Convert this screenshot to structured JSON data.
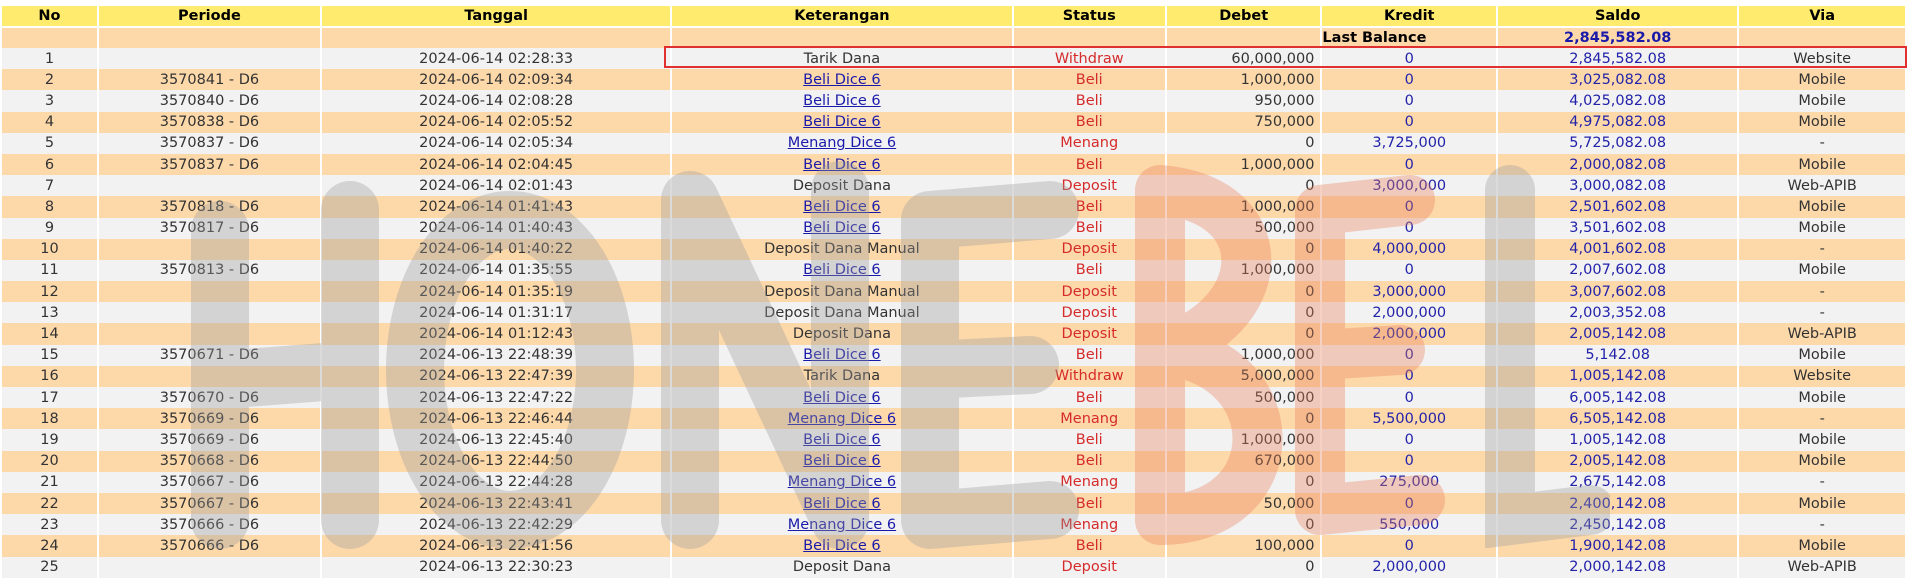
{
  "headers": [
    "No",
    "Periode",
    "Tanggal",
    "Keterangan",
    "Status",
    "Debet",
    "Kredit",
    "Saldo",
    "Via"
  ],
  "last_balance": {
    "label": "Last Balance",
    "value": "2,845,582.08"
  },
  "rows": [
    {
      "no": "1",
      "periode": "",
      "tanggal": "2024-06-14 02:28:33",
      "keterangan": "Tarik Dana",
      "link": false,
      "status": "Withdraw",
      "debet": "60,000,000",
      "kredit": "0",
      "saldo": "2,845,582.08",
      "via": "Website"
    },
    {
      "no": "2",
      "periode": "3570841 - D6",
      "tanggal": "2024-06-14 02:09:34",
      "keterangan": "Beli Dice 6",
      "link": true,
      "status": "Beli",
      "debet": "1,000,000",
      "kredit": "0",
      "saldo": "3,025,082.08",
      "via": "Mobile"
    },
    {
      "no": "3",
      "periode": "3570840 - D6",
      "tanggal": "2024-06-14 02:08:28",
      "keterangan": "Beli Dice 6",
      "link": true,
      "status": "Beli",
      "debet": "950,000",
      "kredit": "0",
      "saldo": "4,025,082.08",
      "via": "Mobile"
    },
    {
      "no": "4",
      "periode": "3570838 - D6",
      "tanggal": "2024-06-14 02:05:52",
      "keterangan": "Beli Dice 6",
      "link": true,
      "status": "Beli",
      "debet": "750,000",
      "kredit": "0",
      "saldo": "4,975,082.08",
      "via": "Mobile"
    },
    {
      "no": "5",
      "periode": "3570837 - D6",
      "tanggal": "2024-06-14 02:05:34",
      "keterangan": "Menang Dice 6",
      "link": true,
      "status": "Menang",
      "debet": "0",
      "kredit": "3,725,000",
      "saldo": "5,725,082.08",
      "via": "-"
    },
    {
      "no": "6",
      "periode": "3570837 - D6",
      "tanggal": "2024-06-14 02:04:45",
      "keterangan": "Beli Dice 6",
      "link": true,
      "status": "Beli",
      "debet": "1,000,000",
      "kredit": "0",
      "saldo": "2,000,082.08",
      "via": "Mobile"
    },
    {
      "no": "7",
      "periode": "",
      "tanggal": "2024-06-14 02:01:43",
      "keterangan": "Deposit Dana",
      "link": false,
      "status": "Deposit",
      "debet": "0",
      "kredit": "3,000,000",
      "saldo": "3,000,082.08",
      "via": "Web-APIB"
    },
    {
      "no": "8",
      "periode": "3570818 - D6",
      "tanggal": "2024-06-14 01:41:43",
      "keterangan": "Beli Dice 6",
      "link": true,
      "status": "Beli",
      "debet": "1,000,000",
      "kredit": "0",
      "saldo": "2,501,602.08",
      "via": "Mobile"
    },
    {
      "no": "9",
      "periode": "3570817 - D6",
      "tanggal": "2024-06-14 01:40:43",
      "keterangan": "Beli Dice 6",
      "link": true,
      "status": "Beli",
      "debet": "500,000",
      "kredit": "0",
      "saldo": "3,501,602.08",
      "via": "Mobile"
    },
    {
      "no": "10",
      "periode": "",
      "tanggal": "2024-06-14 01:40:22",
      "keterangan": "Deposit Dana Manual",
      "link": false,
      "status": "Deposit",
      "debet": "0",
      "kredit": "4,000,000",
      "saldo": "4,001,602.08",
      "via": "-"
    },
    {
      "no": "11",
      "periode": "3570813 - D6",
      "tanggal": "2024-06-14 01:35:55",
      "keterangan": "Beli Dice 6",
      "link": true,
      "status": "Beli",
      "debet": "1,000,000",
      "kredit": "0",
      "saldo": "2,007,602.08",
      "via": "Mobile"
    },
    {
      "no": "12",
      "periode": "",
      "tanggal": "2024-06-14 01:35:19",
      "keterangan": "Deposit Dana Manual",
      "link": false,
      "status": "Deposit",
      "debet": "0",
      "kredit": "3,000,000",
      "saldo": "3,007,602.08",
      "via": "-"
    },
    {
      "no": "13",
      "periode": "",
      "tanggal": "2024-06-14 01:31:17",
      "keterangan": "Deposit Dana Manual",
      "link": false,
      "status": "Deposit",
      "debet": "0",
      "kredit": "2,000,000",
      "saldo": "2,003,352.08",
      "via": "-"
    },
    {
      "no": "14",
      "periode": "",
      "tanggal": "2024-06-14 01:12:43",
      "keterangan": "Deposit Dana",
      "link": false,
      "status": "Deposit",
      "debet": "0",
      "kredit": "2,000,000",
      "saldo": "2,005,142.08",
      "via": "Web-APIB"
    },
    {
      "no": "15",
      "periode": "3570671 - D6",
      "tanggal": "2024-06-13 22:48:39",
      "keterangan": "Beli Dice 6",
      "link": true,
      "status": "Beli",
      "debet": "1,000,000",
      "kredit": "0",
      "saldo": "5,142.08",
      "via": "Mobile"
    },
    {
      "no": "16",
      "periode": "",
      "tanggal": "2024-06-13 22:47:39",
      "keterangan": "Tarik Dana",
      "link": false,
      "status": "Withdraw",
      "debet": "5,000,000",
      "kredit": "0",
      "saldo": "1,005,142.08",
      "via": "Website"
    },
    {
      "no": "17",
      "periode": "3570670 - D6",
      "tanggal": "2024-06-13 22:47:22",
      "keterangan": "Beli Dice 6",
      "link": true,
      "status": "Beli",
      "debet": "500,000",
      "kredit": "0",
      "saldo": "6,005,142.08",
      "via": "Mobile"
    },
    {
      "no": "18",
      "periode": "3570669 - D6",
      "tanggal": "2024-06-13 22:46:44",
      "keterangan": "Menang Dice 6",
      "link": true,
      "status": "Menang",
      "debet": "0",
      "kredit": "5,500,000",
      "saldo": "6,505,142.08",
      "via": "-"
    },
    {
      "no": "19",
      "periode": "3570669 - D6",
      "tanggal": "2024-06-13 22:45:40",
      "keterangan": "Beli Dice 6",
      "link": true,
      "status": "Beli",
      "debet": "1,000,000",
      "kredit": "0",
      "saldo": "1,005,142.08",
      "via": "Mobile"
    },
    {
      "no": "20",
      "periode": "3570668 - D6",
      "tanggal": "2024-06-13 22:44:50",
      "keterangan": "Beli Dice 6",
      "link": true,
      "status": "Beli",
      "debet": "670,000",
      "kredit": "0",
      "saldo": "2,005,142.08",
      "via": "Mobile"
    },
    {
      "no": "21",
      "periode": "3570667 - D6",
      "tanggal": "2024-06-13 22:44:28",
      "keterangan": "Menang Dice 6",
      "link": true,
      "status": "Menang",
      "debet": "0",
      "kredit": "275,000",
      "saldo": "2,675,142.08",
      "via": "-"
    },
    {
      "no": "22",
      "periode": "3570667 - D6",
      "tanggal": "2024-06-13 22:43:41",
      "keterangan": "Beli Dice 6",
      "link": true,
      "status": "Beli",
      "debet": "50,000",
      "kredit": "0",
      "saldo": "2,400,142.08",
      "via": "Mobile"
    },
    {
      "no": "23",
      "periode": "3570666 - D6",
      "tanggal": "2024-06-13 22:42:29",
      "keterangan": "Menang Dice 6",
      "link": true,
      "status": "Menang",
      "debet": "0",
      "kredit": "550,000",
      "saldo": "2,450,142.08",
      "via": "-"
    },
    {
      "no": "24",
      "periode": "3570666 - D6",
      "tanggal": "2024-06-13 22:41:56",
      "keterangan": "Beli Dice 6",
      "link": true,
      "status": "Beli",
      "debet": "100,000",
      "kredit": "0",
      "saldo": "1,900,142.08",
      "via": "Mobile"
    },
    {
      "no": "25",
      "periode": "",
      "tanggal": "2024-06-13 22:30:23",
      "keterangan": "Deposit Dana",
      "link": false,
      "status": "Deposit",
      "debet": "0",
      "kredit": "2,000,000",
      "saldo": "2,000,142.08",
      "via": "Web-APIB"
    }
  ],
  "colors": {
    "header_bg": "#ffec6e",
    "row_odd": "#f2f2f2",
    "row_even": "#fdd9aa",
    "status_red": "#d52b2b",
    "amount_blue": "#2222aa",
    "highlight": "#e03030"
  },
  "selected_row": 1
}
